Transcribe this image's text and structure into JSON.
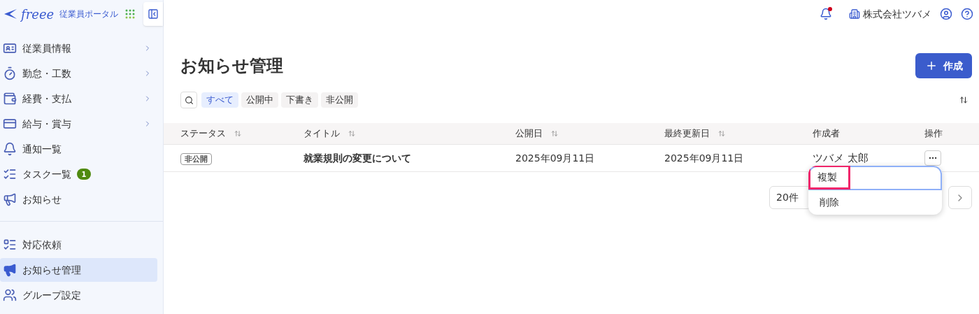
{
  "brand": {
    "logo": "freee",
    "product": "従業員ポータル"
  },
  "header": {
    "company": "株式会社ツバメ",
    "notification_unread": true
  },
  "sidebar": {
    "sections": [
      {
        "items": [
          {
            "label": "従業員情報",
            "has_submenu": true,
            "selected": false
          },
          {
            "label": "勤怠・工数",
            "has_submenu": true,
            "selected": false
          },
          {
            "label": "経費・支払",
            "has_submenu": true,
            "selected": false
          },
          {
            "label": "給与・賞与",
            "has_submenu": true,
            "selected": false
          },
          {
            "label": "通知一覧",
            "has_submenu": false,
            "selected": false
          },
          {
            "label": "タスク一覧",
            "has_submenu": false,
            "selected": false,
            "badge": "1"
          },
          {
            "label": "お知らせ",
            "has_submenu": false,
            "selected": false
          }
        ]
      },
      {
        "items": [
          {
            "label": "対応依頼",
            "has_submenu": false,
            "selected": false
          },
          {
            "label": "お知らせ管理",
            "has_submenu": false,
            "selected": true
          },
          {
            "label": "グループ設定",
            "has_submenu": false,
            "selected": false
          }
        ]
      }
    ]
  },
  "page": {
    "title": "お知らせ管理",
    "create_button": "作成"
  },
  "filters": [
    {
      "label": "すべて",
      "selected": true
    },
    {
      "label": "公開中",
      "selected": false
    },
    {
      "label": "下書き",
      "selected": false
    },
    {
      "label": "非公開",
      "selected": false
    }
  ],
  "table": {
    "columns": [
      {
        "label": "ステータス",
        "sortable": true
      },
      {
        "label": "タイトル",
        "sortable": true
      },
      {
        "label": "公開日",
        "sortable": true
      },
      {
        "label": "最終更新日",
        "sortable": true
      },
      {
        "label": "作成者",
        "sortable": false
      },
      {
        "label": "操作",
        "sortable": false
      }
    ],
    "rows": [
      {
        "status": "非公開",
        "title": "就業規則の変更について",
        "published": "2025年09月11日",
        "updated": "2025年09月11日",
        "author": "ツバメ 太郎"
      }
    ]
  },
  "pagination": {
    "per_page": "20件"
  },
  "action_menu": {
    "items": [
      {
        "label": "複製",
        "highlighted": true
      },
      {
        "label": "削除",
        "highlighted": false
      }
    ]
  }
}
